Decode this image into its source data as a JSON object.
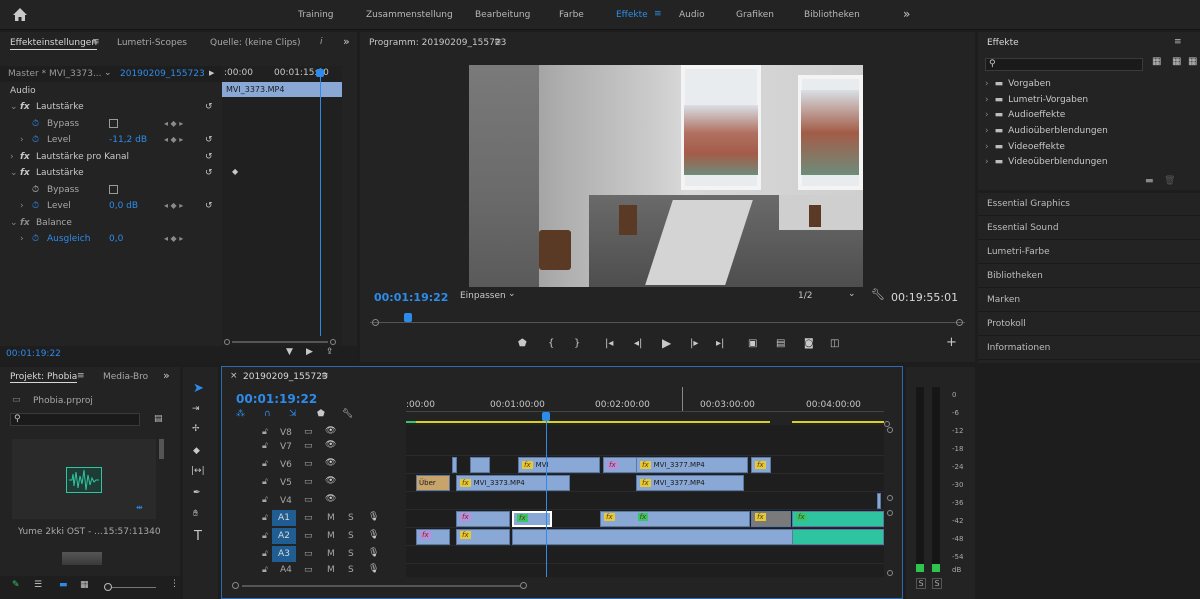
{
  "workspaces": {
    "items": [
      "Training",
      "Zusammenstellung",
      "Bearbeitung",
      "Farbe",
      "Effekte",
      "Audio",
      "Grafiken",
      "Bibliotheken"
    ],
    "active_index": 4,
    "more": "»"
  },
  "effect_controls": {
    "tabs": [
      "Effekteinstellungen",
      "Lumetri-Scopes",
      "Quelle: (keine Clips)"
    ],
    "master": "Master * MVI_3373...",
    "sequence": "20190209_155723",
    "ruler": [
      ":00:00",
      "00:01:15:00"
    ],
    "clip_label": "MVI_3373.MP4",
    "section": "Audio",
    "rows": [
      {
        "label": "Lautstärke",
        "type": "fx"
      },
      {
        "label": "Bypass",
        "type": "param"
      },
      {
        "label": "Level",
        "type": "param",
        "value": "-11,2 dB"
      },
      {
        "label": "Lautstärke pro Kanal",
        "type": "fx"
      },
      {
        "label": "Lautstärke",
        "type": "fx"
      },
      {
        "label": "Bypass",
        "type": "param"
      },
      {
        "label": "Level",
        "type": "param",
        "value": "0,0 dB"
      },
      {
        "label": "Balance",
        "type": "fx"
      },
      {
        "label": "Ausgleich",
        "type": "param",
        "value": "0,0"
      }
    ],
    "timecode": "00:01:19:22"
  },
  "program": {
    "title": "Programm: 20190209_155723",
    "timecode": "00:01:19:22",
    "fit": "Einpassen",
    "resolution": "1/2",
    "duration": "00:19:55:01"
  },
  "effects_panel": {
    "title": "Effekte",
    "search_placeholder": "",
    "folders": [
      "Vorgaben",
      "Lumetri-Vorgaben",
      "Audioeffekte",
      "Audioüberblendungen",
      "Videoeffekte",
      "Videoüberblendungen"
    ],
    "sections": [
      "Essential Graphics",
      "Essential Sound",
      "Lumetri-Farbe",
      "Bibliotheken",
      "Marken",
      "Protokoll",
      "Informationen"
    ]
  },
  "project": {
    "tabs": [
      "Projekt: Phobia",
      "Media-Bro"
    ],
    "file": "Phobia.prproj",
    "item_name": "Yume 2kki OST - ...",
    "item_duration": "15:57:11340"
  },
  "timeline": {
    "tab": "20190209_155723",
    "timecode": "00:01:19:22",
    "ruler": [
      ":00:00",
      "00:01:00:00",
      "00:02:00:00",
      "00:03:00:00",
      "00:04:00:00"
    ],
    "video_tracks": [
      "V8",
      "V7",
      "V6",
      "V5",
      "V4"
    ],
    "audio_tracks": [
      "A1",
      "A2",
      "A3",
      "A4"
    ],
    "clips": {
      "v6a": "MVI",
      "v6b": "MVI_3377.MP4",
      "v5a": "MVI_3373.MP4",
      "v5b": "MVI_3377.MP4",
      "v5x": "Über"
    }
  },
  "meter": {
    "scale": [
      "0",
      "-6",
      "-12",
      "-18",
      "-24",
      "-30",
      "-36",
      "-42",
      "-48",
      "-54",
      "dB"
    ],
    "solo": [
      "S",
      "S"
    ]
  }
}
